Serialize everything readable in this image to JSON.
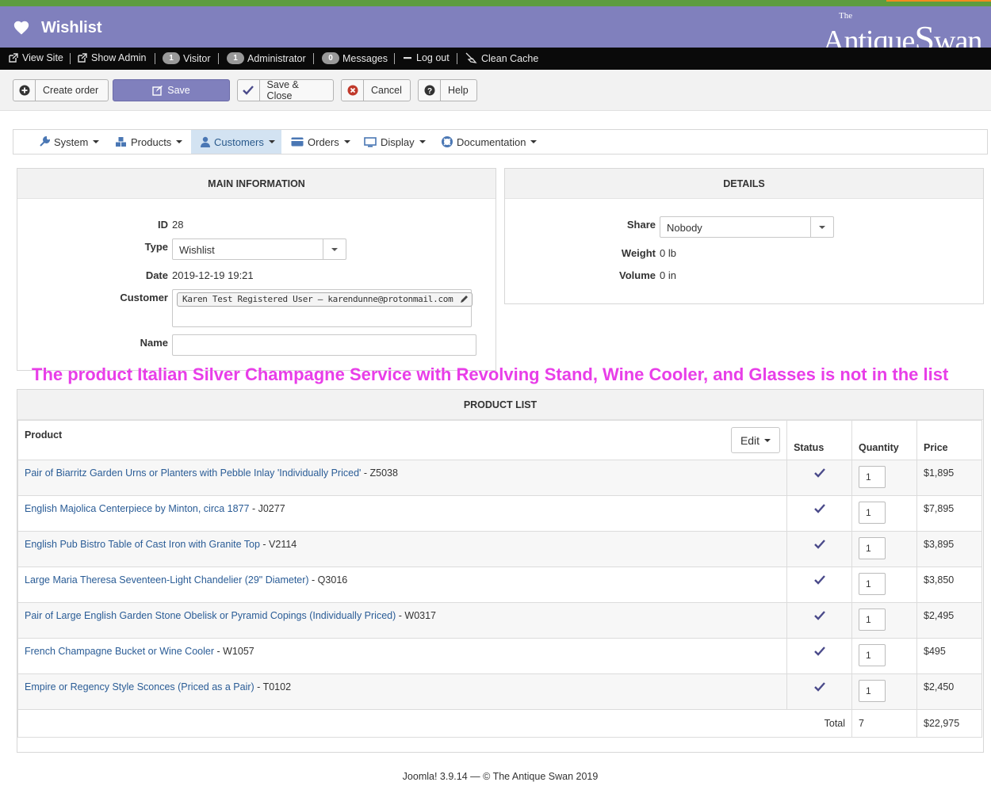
{
  "header": {
    "title": "Wishlist",
    "logo_small": "The",
    "logo": "AntiqueSwan"
  },
  "statusbar": {
    "view_site": "View Site",
    "show_admin": "Show Admin",
    "visitor_count": "1",
    "visitor_label": "Visitor",
    "admin_count": "1",
    "admin_label": "Administrator",
    "messages_count": "0",
    "messages_label": "Messages",
    "logout": "Log out",
    "clean_cache": "Clean Cache"
  },
  "toolbar": {
    "create_order": "Create order",
    "save": "Save",
    "save_close": "Save & Close",
    "cancel": "Cancel",
    "help": "Help"
  },
  "menu": {
    "system": "System",
    "products": "Products",
    "customers": "Customers",
    "orders": "Orders",
    "display": "Display",
    "documentation": "Documentation"
  },
  "main_info": {
    "heading": "MAIN INFORMATION",
    "id_label": "ID",
    "id_value": "28",
    "type_label": "Type",
    "type_value": "Wishlist",
    "date_label": "Date",
    "date_value": "2019-12-19 19:21",
    "customer_label": "Customer",
    "customer_value": "Karen Test Registered User – karendunne@protonmail.com",
    "name_label": "Name",
    "name_value": ""
  },
  "details": {
    "heading": "DETAILS",
    "share_label": "Share",
    "share_value": "Nobody",
    "weight_label": "Weight",
    "weight_value": "0 lb",
    "volume_label": "Volume",
    "volume_value": "0 in"
  },
  "overlay_message": "The product Italian Silver Champagne Service with Revolving Stand, Wine Cooler, and Glasses is not in the list",
  "product_list": {
    "heading": "PRODUCT LIST",
    "columns": {
      "product": "Product",
      "edit": "Edit",
      "status": "Status",
      "quantity": "Quantity",
      "price": "Price"
    },
    "rows": [
      {
        "name": "Pair of Biarritz Garden Urns or Planters with Pebble Inlay 'Individually Priced'",
        "code": " - Z5038",
        "qty": "1",
        "price": "$1,895"
      },
      {
        "name": "English Majolica Centerpiece by Minton, circa 1877",
        "code": " - J0277",
        "qty": "1",
        "price": "$7,895"
      },
      {
        "name": "English Pub Bistro Table of Cast Iron with Granite Top",
        "code": " - V2114",
        "qty": "1",
        "price": "$3,895"
      },
      {
        "name": "Large Maria Theresa Seventeen-Light Chandelier (29\" Diameter)",
        "code": " - Q3016",
        "qty": "1",
        "price": "$3,850"
      },
      {
        "name": "Pair of Large English Garden Stone Obelisk or Pyramid Copings (Individually Priced)",
        "code": " - W0317",
        "qty": "1",
        "price": "$2,495"
      },
      {
        "name": "French Champagne Bucket or Wine Cooler",
        "code": " - W1057",
        "qty": "1",
        "price": "$495"
      },
      {
        "name": "Empire or Regency Style Sconces (Priced as a Pair)",
        "code": " - T0102",
        "qty": "1",
        "price": "$2,450"
      }
    ],
    "total_label": "Total",
    "total_qty": "7",
    "total_price": "$22,975"
  },
  "footer": "Joomla! 3.9.14  —  © The Antique Swan 2019",
  "colors": {
    "header": "#8080bd",
    "link": "#2a5c96",
    "overlay": "#e83ee8",
    "active_menu": "#d3e3f2"
  }
}
